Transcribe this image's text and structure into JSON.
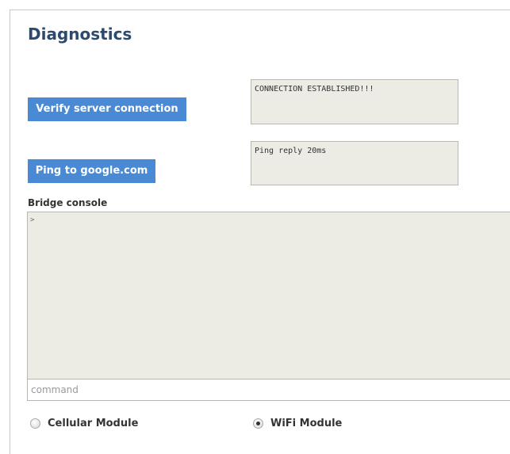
{
  "header": {
    "title": "Diagnostics"
  },
  "verify": {
    "button_label": "Verify server connection",
    "output": "CONNECTION ESTABLISHED!!!"
  },
  "ping": {
    "button_label": "Ping to google.com",
    "output": "Ping reply 20ms"
  },
  "console": {
    "label": "Bridge console",
    "content": ">",
    "command_placeholder": "command",
    "command_value": ""
  },
  "modules": {
    "options": [
      {
        "label": "Cellular Module",
        "selected": false
      },
      {
        "label": "WiFi Module",
        "selected": true
      }
    ]
  },
  "colors": {
    "accent": "#4a8ad4",
    "title": "#2c4a6b",
    "output_bg": "#ecece4"
  }
}
